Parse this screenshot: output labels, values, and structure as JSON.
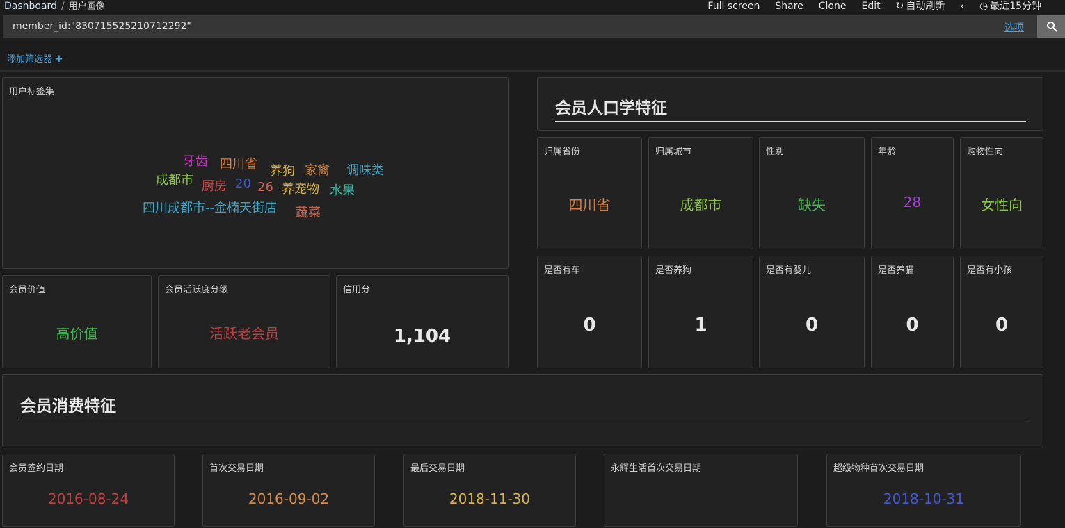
{
  "header": {
    "breadcrumb_root": "Dashboard",
    "breadcrumb_sep": "/",
    "breadcrumb_current": "用户画像",
    "menu": {
      "fullscreen": "Full screen",
      "share": "Share",
      "clone": "Clone",
      "edit": "Edit",
      "auto_refresh": "自动刷新",
      "time_range": "最近15分钟"
    }
  },
  "query": {
    "value": "member_id:\"830715525210712292\"",
    "options_label": "选项"
  },
  "filters": {
    "add_label": "添加筛选器"
  },
  "tag_cloud": {
    "title": "用户标签集",
    "words": [
      {
        "text": "牙齿",
        "color": "#c23cc0"
      },
      {
        "text": "四川省",
        "color": "#d67b3a"
      },
      {
        "text": "养狗",
        "color": "#d9b24a"
      },
      {
        "text": "家禽",
        "color": "#d68a45"
      },
      {
        "text": "调味类",
        "color": "#3aa6c7"
      },
      {
        "text": "成都市",
        "color": "#88c443"
      },
      {
        "text": "厨房",
        "color": "#c04646"
      },
      {
        "text": "20",
        "color": "#3f57d6"
      },
      {
        "text": "26",
        "color": "#d0604a"
      },
      {
        "text": "养宠物",
        "color": "#d9b24a"
      },
      {
        "text": "水果",
        "color": "#2fb3a0"
      },
      {
        "text": "四川成都市--金楠天街店",
        "color": "#3aa6c7"
      },
      {
        "text": "蔬菜",
        "color": "#d0604a"
      }
    ]
  },
  "member_value": {
    "title": "会员价值",
    "value": "高价值",
    "color": "#3fb54e"
  },
  "member_activity": {
    "title": "会员活跃度分级",
    "value": "活跃老会员",
    "color": "#c23c3c"
  },
  "credit_score": {
    "title": "信用分",
    "value": "1,104"
  },
  "demographics": {
    "heading": "会员人口学特征",
    "cards_top": [
      {
        "title": "归属省份",
        "value": "四川省",
        "color": "#d67b3a"
      },
      {
        "title": "归属城市",
        "value": "成都市",
        "color": "#88c443"
      },
      {
        "title": "性别",
        "value": "缺失",
        "color": "#3fb54e"
      },
      {
        "title": "年龄",
        "value": "28",
        "color": "#a63fd6"
      },
      {
        "title": "购物性向",
        "value": "女性向",
        "color": "#88c443"
      }
    ],
    "cards_bottom": [
      {
        "title": "是否有车",
        "value": "0"
      },
      {
        "title": "是否养狗",
        "value": "1"
      },
      {
        "title": "是否有婴儿",
        "value": "0"
      },
      {
        "title": "是否养猫",
        "value": "0"
      },
      {
        "title": "是否有小孩",
        "value": "0"
      }
    ]
  },
  "consumption": {
    "heading": "会员消费特征",
    "cards": [
      {
        "title": "会员签约日期",
        "value": "2016-08-24",
        "color": "#c23c3c"
      },
      {
        "title": "首次交易日期",
        "value": "2016-09-02",
        "color": "#d68a45"
      },
      {
        "title": "最后交易日期",
        "value": "2018-11-30",
        "color": "#d9b24a"
      },
      {
        "title": "永辉生活首次交易日期",
        "value": "",
        "color": "#d8d8d8"
      },
      {
        "title": "超级物种首次交易日期",
        "value": "2018-10-31",
        "color": "#3f57d6"
      }
    ]
  }
}
